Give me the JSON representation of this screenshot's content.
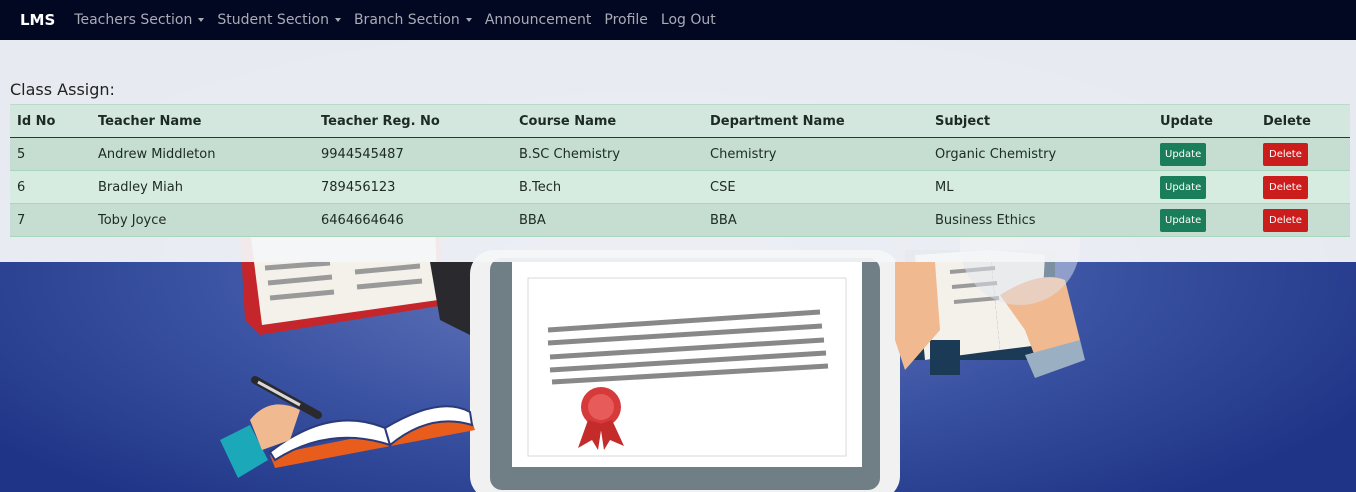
{
  "navbar": {
    "brand": "LMS",
    "items": [
      {
        "label": "Teachers Section",
        "dropdown": true
      },
      {
        "label": "Student Section",
        "dropdown": true
      },
      {
        "label": "Branch Section",
        "dropdown": true
      },
      {
        "label": "Announcement",
        "dropdown": false
      },
      {
        "label": "Profile",
        "dropdown": false
      },
      {
        "label": "Log Out",
        "dropdown": false
      }
    ]
  },
  "page": {
    "title": "Class Assign:"
  },
  "table": {
    "headers": [
      "Id No",
      "Teacher Name",
      "Teacher Reg. No",
      "Course Name",
      "Department Name",
      "Subject",
      "Update",
      "Delete"
    ],
    "rows": [
      [
        "5",
        "Andrew Middleton",
        "9944545487",
        "B.SC Chemistry",
        "Chemistry",
        "Organic Chemistry"
      ],
      [
        "6",
        "Bradley Miah",
        "789456123",
        "B.Tech",
        "CSE",
        "ML"
      ],
      [
        "7",
        "Toby Joyce",
        "6464664646",
        "BBA",
        "BBA",
        "Business Ethics"
      ]
    ],
    "update_label": "Update",
    "delete_label": "Delete"
  },
  "colors": {
    "navbar": "#020722",
    "background": "#243a8c",
    "update_button": "#1a7e5a",
    "delete_button": "#cc1d1d"
  }
}
